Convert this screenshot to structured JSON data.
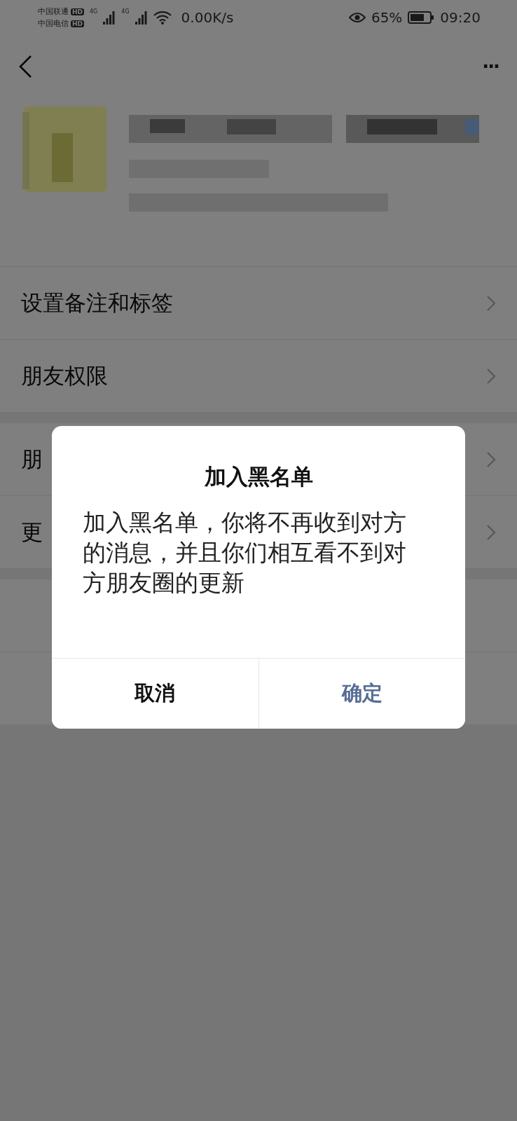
{
  "status_bar": {
    "carrier_1": "中国联通",
    "carrier_2": "中国电信",
    "hd_1": "HD",
    "hd_2": "HD",
    "net_1": "4G",
    "net_2": "4G",
    "speed": "0.00K/s",
    "battery": "65%",
    "time": "09:20"
  },
  "nav": {
    "more": "···"
  },
  "menu_groups": [
    [
      {
        "label": "设置备注和标签"
      },
      {
        "label": "朋友权限"
      }
    ],
    [
      {
        "label": "朋"
      },
      {
        "label": "更"
      }
    ]
  ],
  "dialog": {
    "title": "加入黑名单",
    "message": "加入黑名单，你将不再收到对方的消息，并且你们相互看不到对方朋友圈的更新",
    "buttons": [
      {
        "label": "取消",
        "kind": "cancel"
      },
      {
        "label": "确定",
        "kind": "confirm"
      }
    ]
  }
}
